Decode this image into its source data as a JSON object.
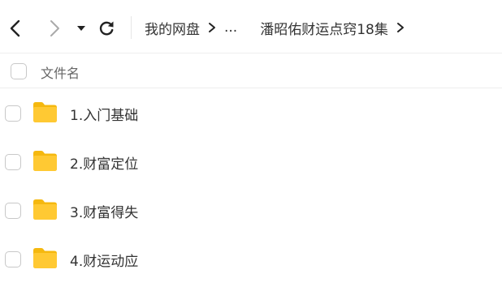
{
  "toolbar": {
    "back_icon": "chevron-left-icon",
    "forward_icon": "chevron-right-icon",
    "dropdown_icon": "caret-down-icon",
    "refresh_icon": "refresh-icon"
  },
  "breadcrumb": {
    "root": "我的网盘",
    "ellipsis": "...",
    "current": "潘昭佑财运点窍18集"
  },
  "list": {
    "column_name": "文件名",
    "items": [
      {
        "label": "1.入门基础",
        "type": "folder"
      },
      {
        "label": "2.财富定位",
        "type": "folder"
      },
      {
        "label": "3.财富得失",
        "type": "folder"
      },
      {
        "label": "4.财运动应",
        "type": "folder"
      }
    ]
  },
  "colors": {
    "folder": "#FFC933",
    "folder_dark": "#F5B80F",
    "border": "#EEEEEE",
    "text": "#333333",
    "muted_text": "#666666",
    "disabled_icon": "#AAAAAA"
  }
}
